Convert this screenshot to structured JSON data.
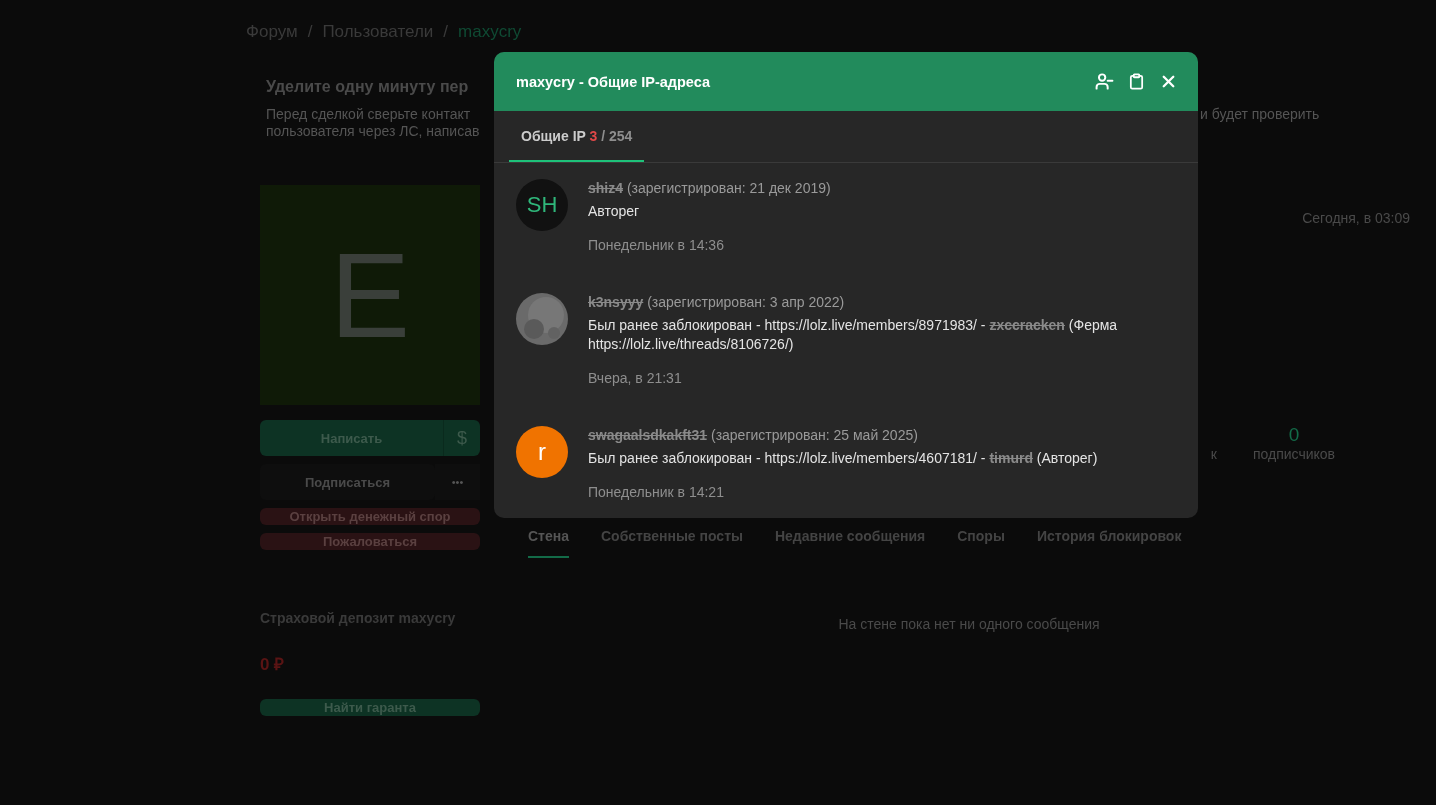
{
  "breadcrumbs": [
    {
      "label": "Форум",
      "selected": false
    },
    {
      "label": "Пользователи",
      "selected": false
    },
    {
      "label": "maxycry",
      "selected": true
    }
  ],
  "breadcrumb_separator": "/",
  "notice": {
    "title": "Уделите одну минуту пер",
    "lines": [
      "Перед сделкой сверьте контакт",
      "пользователя через ЛС, написав"
    ],
    "right_text": "и будет проверить"
  },
  "profile": {
    "avatar_letter": "E",
    "write_button": "Написать",
    "money_icon": "$",
    "subscribe_button": "Подписаться",
    "more_icon": "•••",
    "dispute_button": "Открыть денежный спор",
    "report_button": "Пожаловаться",
    "deposit_title": "Страховой депозит maxycry",
    "deposit_amount": "0 ₽",
    "guarantor_button": "Найти гаранта"
  },
  "last_seen": "Сегодня, в 03:09",
  "stats": [
    {
      "label": "к"
    },
    {
      "value": "0",
      "label": "подписчиков"
    }
  ],
  "profile_tabs": [
    {
      "label": "Стена",
      "selected": true
    },
    {
      "label": "Собственные посты",
      "selected": false
    },
    {
      "label": "Недавние сообщения",
      "selected": false
    },
    {
      "label": "Споры",
      "selected": false
    },
    {
      "label": "История блокировок",
      "selected": false
    }
  ],
  "wall_empty": "На стене пока нет ни одного сообщения",
  "modal": {
    "title": "maxycry - Общие IP-адреса",
    "tabs": [
      {
        "label": "Общие IP",
        "count": "3",
        "total": "/ 254",
        "selected": true
      }
    ],
    "entries": [
      {
        "avatar": {
          "kind": "initials",
          "text": "SH"
        },
        "username": "shiz4",
        "struck": true,
        "registered": "(зарегистрирован: 21 дек 2019)",
        "message": [
          {
            "text": "Авторег",
            "struck": false
          }
        ],
        "time": "Понедельник в 14:36"
      },
      {
        "username": "k3nsyyy",
        "struck": true,
        "registered": "(зарегистрирован: 3 апр 2022)",
        "message": [
          {
            "text": "Был ранее заблокирован - https://lolz.live/members/8971983/ - ",
            "struck": false
          },
          {
            "text": "zxccracken",
            "struck": true
          },
          {
            "text": " (Ферма https://lolz.live/threads/8106726/)",
            "struck": false
          }
        ],
        "time": "Вчера, в 21:31"
      },
      {
        "avatar": {
          "kind": "letter",
          "text": "r",
          "color": "#f07300"
        },
        "username": "swagaalsdkakft31",
        "struck": true,
        "registered": "(зарегистрирован: 25 май 2025)",
        "message": [
          {
            "text": "Был ранее заблокирован - https://lolz.live/members/4607181/ - ",
            "struck": false
          },
          {
            "text": "timurd",
            "struck": true
          },
          {
            "text": " (Авторег)",
            "struck": false
          }
        ],
        "time": "Понедельник в 14:21"
      }
    ]
  }
}
